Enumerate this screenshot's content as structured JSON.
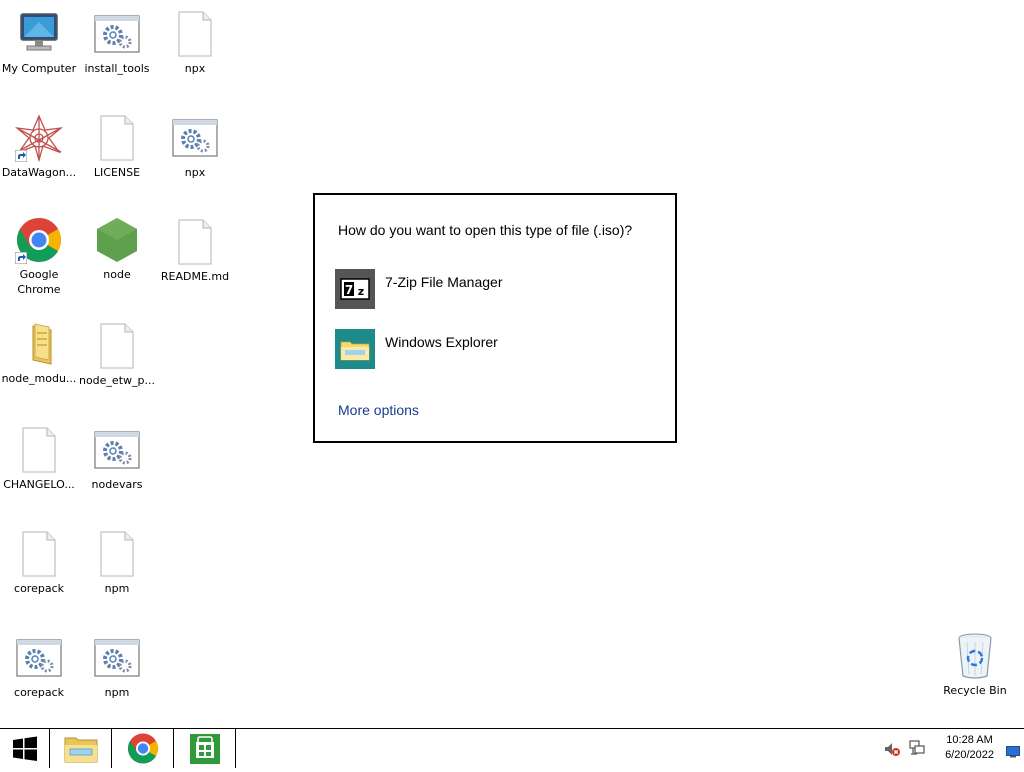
{
  "desktop": {
    "icons": [
      {
        "label": "My Computer",
        "icon": "computer-icon"
      },
      {
        "label": "install_tools",
        "icon": "batch-file-icon"
      },
      {
        "label": "npx",
        "icon": "blank-file-icon"
      },
      {
        "label": "DataWagon...",
        "icon": "datawagon-shortcut-icon"
      },
      {
        "label": "LICENSE",
        "icon": "blank-file-icon"
      },
      {
        "label": "npx",
        "icon": "batch-file-icon"
      },
      {
        "label": "Google Chrome",
        "icon": "chrome-shortcut-icon"
      },
      {
        "label": "node",
        "icon": "nodejs-icon"
      },
      {
        "label": "README.md",
        "icon": "blank-file-icon"
      },
      {
        "label": "node_modu...",
        "icon": "folder-icon"
      },
      {
        "label": "node_etw_p...",
        "icon": "blank-file-icon"
      },
      {
        "label": "CHANGELO...",
        "icon": "blank-file-icon"
      },
      {
        "label": "nodevars",
        "icon": "batch-file-icon"
      },
      {
        "label": "corepack",
        "icon": "blank-file-icon"
      },
      {
        "label": "npm",
        "icon": "blank-file-icon"
      },
      {
        "label": "corepack",
        "icon": "batch-file-icon"
      },
      {
        "label": "npm",
        "icon": "batch-file-icon"
      },
      {
        "label": "Recycle Bin",
        "icon": "recycle-bin-icon"
      }
    ]
  },
  "dialog": {
    "title": "How do you want to open this type of file (.iso)?",
    "options": [
      {
        "label": "7-Zip File Manager",
        "icon": "7zip-icon"
      },
      {
        "label": "Windows Explorer",
        "icon": "windows-explorer-icon"
      }
    ],
    "more_options": "More options"
  },
  "taskbar": {
    "buttons": [
      {
        "name": "start-button",
        "icon": "windows-logo-icon"
      },
      {
        "name": "file-explorer-taskbar-button",
        "icon": "file-explorer-icon"
      },
      {
        "name": "chrome-taskbar-button",
        "icon": "chrome-icon"
      },
      {
        "name": "store-taskbar-button",
        "icon": "store-icon"
      }
    ],
    "tray": {
      "time": "10:28 AM",
      "date": "6/20/2022",
      "icons": [
        "volume-muted-icon",
        "network-icon",
        "show-desktop-icon"
      ]
    }
  },
  "colors": {
    "link": "#1a3c8c",
    "teal_tile": "#1e8a8a",
    "store_green": "#2f9a3a"
  }
}
